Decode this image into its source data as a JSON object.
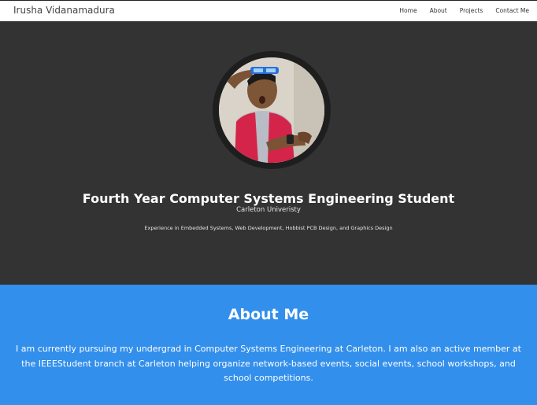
{
  "navbar": {
    "brand": "Irusha Vidanamadura",
    "links": [
      "Home",
      "About",
      "Projects",
      "Contact Me"
    ]
  },
  "hero": {
    "title": "Fourth Year Computer Systems Engineering Student",
    "subtitle": "Carleton Univeristy",
    "tagline": "Experience in Embedded Systems, Web Development, Hobbist PCB Design, and Graphics Design"
  },
  "about": {
    "title": "About Me",
    "body": "I am currently pursuing my undergrad in Computer Systems Engineering at Carleton. I am also an active member at the IEEEStudent branch at Carleton helping organize network-based events, social events, school workshops, and school competitions."
  },
  "colors": {
    "hero_bg": "#333333",
    "about_bg": "#338fec",
    "navbar_bg": "#ffffff"
  }
}
